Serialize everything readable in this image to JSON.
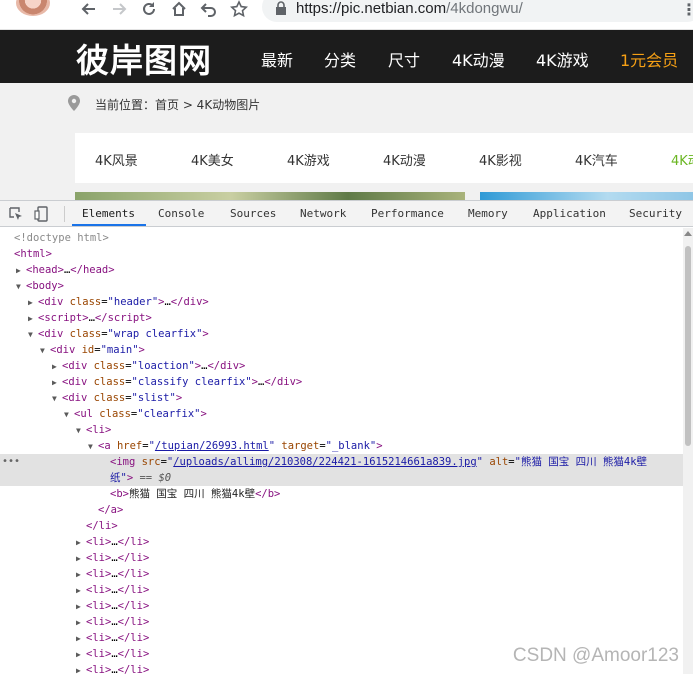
{
  "browser": {
    "url_host": "https://pic.netbian.com",
    "url_path": "/4kdongwu/"
  },
  "site": {
    "logo": "彼岸图网",
    "nav": [
      "最新",
      "分类",
      "尺寸",
      "4K动漫",
      "4K游戏",
      "1元会员"
    ],
    "breadcrumb": "当前位置：首页 > 4K动物图片",
    "categories": [
      "4K风景",
      "4K美女",
      "4K游戏",
      "4K动漫",
      "4K影视",
      "4K汽车",
      "4K动"
    ]
  },
  "devtools": {
    "tabs": [
      "Elements",
      "Console",
      "Sources",
      "Network",
      "Performance",
      "Memory",
      "Application",
      "Security"
    ],
    "active_tab": "Elements",
    "tree": {
      "doctype": "<!doctype html>",
      "html": "html",
      "head": "head",
      "body": "body",
      "header_class": "header",
      "script": "script",
      "wrap_class": "wrap clearfix",
      "main_id": "main",
      "loaction_class": "loaction",
      "classify_class": "classify clearfix",
      "slist_class": "slist",
      "ul_class": "clearfix",
      "li": "li",
      "a_href": "/tupian/26993.html",
      "a_target": "_blank",
      "img_src": "/uploads/allimg/210308/224421-1615214661a839.jpg",
      "img_alt_line1": "熊猫 国宝 四川 熊猫4k壁",
      "img_alt_line2": "纸",
      "eq_marker": "== $0",
      "b_text": "熊猫 国宝 四川 熊猫4k壁",
      "collapsed_li_count": 9
    }
  },
  "watermark": "CSDN @Amoor123"
}
